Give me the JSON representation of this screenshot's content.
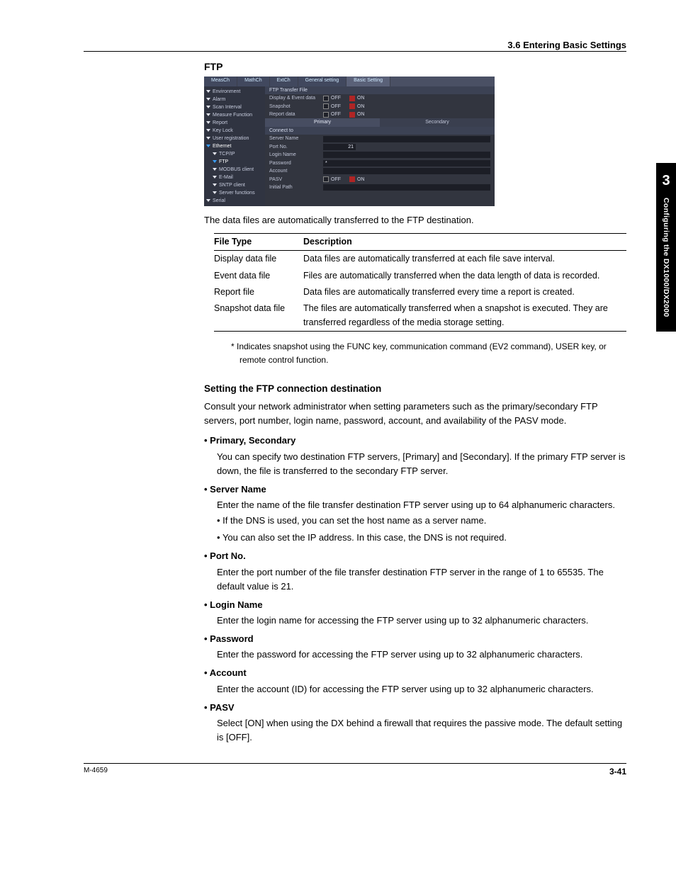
{
  "header": {
    "section": "3.6  Entering Basic Settings"
  },
  "sidebar_tab": {
    "chapter_number": "3",
    "chapter_title": "Configuring the DX1000/DX2000"
  },
  "footer": {
    "left": "M-4659",
    "right": "3-41"
  },
  "title": "FTP",
  "screenshot": {
    "tabs": [
      "MeasCh",
      "MathCh",
      "ExtCh",
      "General setting",
      "Basic Setting"
    ],
    "active_tab": 4,
    "side_items": [
      {
        "label": "Environment",
        "sub": false,
        "sel": false
      },
      {
        "label": "Alarm",
        "sub": false,
        "sel": false
      },
      {
        "label": "Scan Interval",
        "sub": false,
        "sel": false
      },
      {
        "label": "Measure Function",
        "sub": false,
        "sel": false
      },
      {
        "label": "Report",
        "sub": false,
        "sel": false
      },
      {
        "label": "Key Lock",
        "sub": false,
        "sel": false
      },
      {
        "label": "User registration",
        "sub": false,
        "sel": false
      },
      {
        "label": "Ethernet",
        "sub": false,
        "sel": true
      },
      {
        "label": "TCP/IP",
        "sub": true,
        "sel": false
      },
      {
        "label": "FTP",
        "sub": true,
        "sel": true
      },
      {
        "label": "MODBUS client",
        "sub": true,
        "sel": false
      },
      {
        "label": "E-Mail",
        "sub": true,
        "sel": false
      },
      {
        "label": "SNTP client",
        "sub": true,
        "sel": false
      },
      {
        "label": "Server functions",
        "sub": true,
        "sel": false
      },
      {
        "label": "Serial",
        "sub": false,
        "sel": false
      }
    ],
    "main_header": "FTP Transfer File",
    "rows_top": [
      {
        "label": "Display & Event data",
        "off": true
      },
      {
        "label": "Snapshot",
        "off": true
      },
      {
        "label": "Report data",
        "off": true
      }
    ],
    "subtab_primary": "Primary",
    "subtab_secondary": "Secondary",
    "connect_header": "Connect to",
    "fields": {
      "server_name_label": "Server Name",
      "port_no_label": "Port No.",
      "port_no_value": "21",
      "login_name_label": "Login Name",
      "password_label": "Password",
      "password_value": "*",
      "account_label": "Account",
      "pasv_label": "PASV",
      "initial_path_label": "Initial Path"
    },
    "off_label": "OFF",
    "on_label": "ON"
  },
  "intro_para": "The data files are automatically transferred to the FTP destination.",
  "table": {
    "headers": [
      "File Type",
      "Description"
    ],
    "rows": [
      [
        "Display data file",
        "Data files are automatically transferred at each file save interval."
      ],
      [
        "Event data file",
        "Files are automatically transferred when the data length of data is recorded."
      ],
      [
        "Report file",
        "Data files are automatically transferred every time a report is created."
      ],
      [
        "Snapshot data file",
        "The files are automatically transferred when a snapshot is executed. They are transferred regardless of the media storage setting."
      ]
    ]
  },
  "footnote": "*   Indicates snapshot using the FUNC key, communication command (EV2 command), USER key, or remote control function.",
  "section2": {
    "heading": "Setting the FTP connection destination",
    "para": "Consult your network administrator when setting parameters such as the primary/secondary FTP servers, port number, login name, password, account, and availability of the PASV mode.",
    "bullets": [
      {
        "head": "Primary, Secondary",
        "body": "You can specify two destination FTP servers, [Primary] and [Secondary].  If the primary FTP server is down, the file is transferred to the secondary FTP server."
      },
      {
        "head": "Server Name",
        "body": "Enter the name of the file transfer destination FTP server using up to 64 alphanumeric characters.",
        "sub": [
          "If the DNS is used, you can set the host name as a server name.",
          "You can also set the IP address.  In this case, the DNS is not required."
        ]
      },
      {
        "head": "Port No.",
        "body": "Enter the port number of the file transfer destination FTP server in the range of 1 to 65535.  The default value is 21."
      },
      {
        "head": "Login Name",
        "body": "Enter the login name for accessing the FTP server using up to 32 alphanumeric characters."
      },
      {
        "head": "Password",
        "body": "Enter the password for accessing the FTP server using up to 32 alphanumeric characters."
      },
      {
        "head": "Account",
        "body": "Enter the account (ID) for accessing the FTP server using up to 32 alphanumeric characters."
      },
      {
        "head": "PASV",
        "body": "Select [ON] when using the DX behind a firewall that requires the passive mode. The default setting is [OFF]."
      }
    ]
  }
}
